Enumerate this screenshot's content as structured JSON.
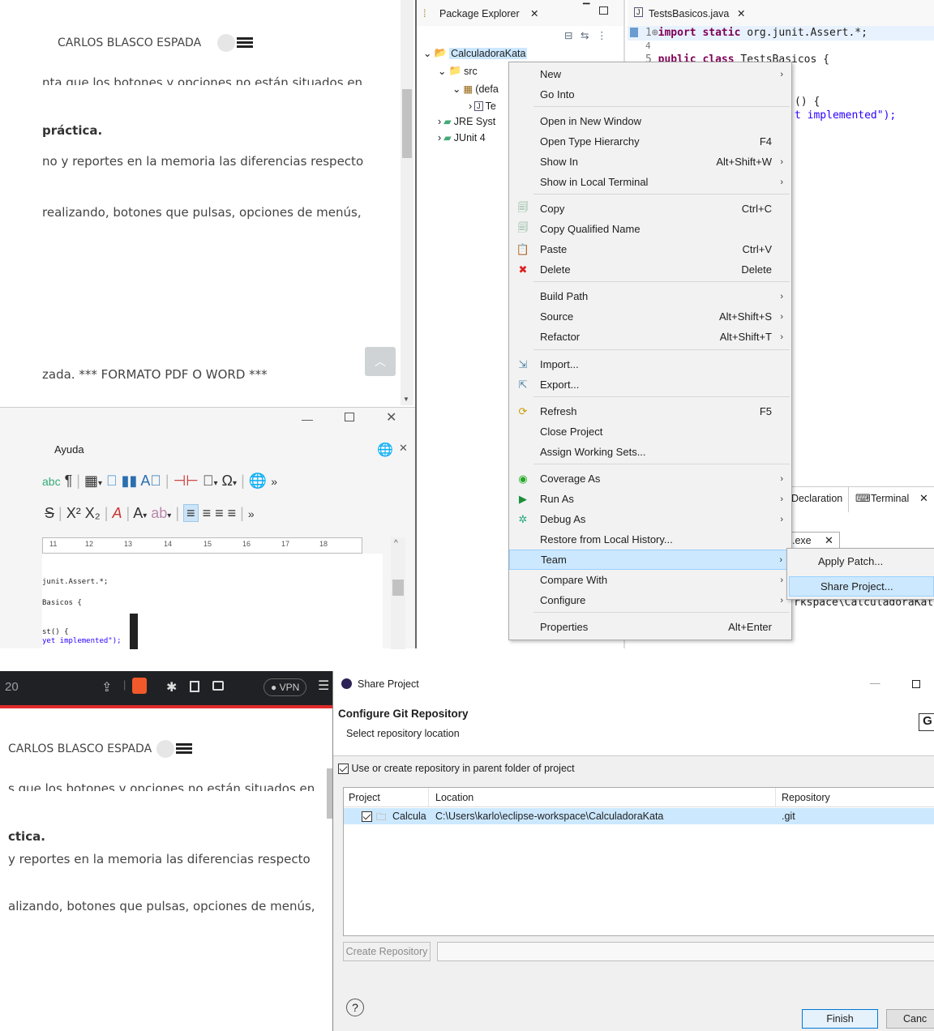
{
  "blog_top": {
    "author": "CARLOS BLASCO ESPADA",
    "line_cut": "nta que los botones y opciones no están situados en",
    "practica": "práctica.",
    "reportes": "no y reportes en la memoria las diferencias respecto",
    "realizando": "realizando, botones que pulsas, opciones de menús,",
    "formato": "zada. *** FORMATO PDF O WORD ***"
  },
  "writer": {
    "menu_label": "Ayuda",
    "ruler_marks": [
      "11",
      "12",
      "13",
      "14",
      "15",
      "16",
      "17",
      "18"
    ],
    "doc_lines": [
      "junit.Assert.*;",
      "Basicos {",
      "st() {",
      "yet implemented\");"
    ]
  },
  "eclipse": {
    "package_explorer_tab": "Package Explorer",
    "editor_tab": "TestsBasicos.java",
    "tree": {
      "project": "CalculadoraKata",
      "src": "src",
      "default_pkg": "(defa",
      "file": "Te",
      "jre": "JRE Syst",
      "junit": "JUnit 4"
    },
    "code": {
      "line1_no": "1⊕",
      "line1_kw": "import static",
      "line1_rest": " org.junit.Assert.*;",
      "line4_no": "4",
      "line5_no": "5",
      "line5_kw": "public class",
      "line5_rest": " TestsBasicos {",
      "line_a": "() {",
      "line_b_str": "t implemented\");"
    },
    "bottom_tabs": {
      "declaration": "Declaration",
      "terminal": "Terminal",
      "exe_tab": ".exe",
      "path": "rkspace\\CalculadoraKata"
    }
  },
  "context_menu": {
    "items": [
      {
        "label": "New",
        "shortcut": "",
        "submenu": true
      },
      {
        "label": "Go Into",
        "shortcut": "",
        "submenu": false
      },
      {
        "label": "Open in New Window",
        "shortcut": "",
        "submenu": false
      },
      {
        "label": "Open Type Hierarchy",
        "shortcut": "F4",
        "submenu": false
      },
      {
        "label": "Show In",
        "shortcut": "Alt+Shift+W",
        "submenu": true
      },
      {
        "label": "Show in Local Terminal",
        "shortcut": "",
        "submenu": true
      },
      {
        "label": "Copy",
        "shortcut": "Ctrl+C",
        "submenu": false
      },
      {
        "label": "Copy Qualified Name",
        "shortcut": "",
        "submenu": false
      },
      {
        "label": "Paste",
        "shortcut": "Ctrl+V",
        "submenu": false
      },
      {
        "label": "Delete",
        "shortcut": "Delete",
        "submenu": false
      },
      {
        "label": "Build Path",
        "shortcut": "",
        "submenu": true
      },
      {
        "label": "Source",
        "shortcut": "Alt+Shift+S",
        "submenu": true
      },
      {
        "label": "Refactor",
        "shortcut": "Alt+Shift+T",
        "submenu": true
      },
      {
        "label": "Import...",
        "shortcut": "",
        "submenu": false
      },
      {
        "label": "Export...",
        "shortcut": "",
        "submenu": false
      },
      {
        "label": "Refresh",
        "shortcut": "F5",
        "submenu": false
      },
      {
        "label": "Close Project",
        "shortcut": "",
        "submenu": false
      },
      {
        "label": "Assign Working Sets...",
        "shortcut": "",
        "submenu": false
      },
      {
        "label": "Coverage As",
        "shortcut": "",
        "submenu": true
      },
      {
        "label": "Run As",
        "shortcut": "",
        "submenu": true
      },
      {
        "label": "Debug As",
        "shortcut": "",
        "submenu": true
      },
      {
        "label": "Restore from Local History...",
        "shortcut": "",
        "submenu": false
      },
      {
        "label": "Team",
        "shortcut": "",
        "submenu": true
      },
      {
        "label": "Compare With",
        "shortcut": "",
        "submenu": true
      },
      {
        "label": "Configure",
        "shortcut": "",
        "submenu": true
      },
      {
        "label": "Properties",
        "shortcut": "Alt+Enter",
        "submenu": false
      }
    ],
    "team_submenu": [
      "Apply Patch...",
      "Share Project..."
    ]
  },
  "browser": {
    "tab_fragment": "20",
    "vpn": "VPN"
  },
  "blog_bottom": {
    "author": "CARLOS BLASCO ESPADA",
    "line_cut": "s que los botones y opciones no están situados en",
    "practica": "ctica.",
    "reportes": "y reportes en la memoria las diferencias respecto",
    "realizando": "alizando, botones que pulsas, opciones de menús,"
  },
  "dialog": {
    "title": "Share Project",
    "heading": "Configure Git Repository",
    "subheading": "Select repository location",
    "checkbox_label": "Use or create repository in parent folder of project",
    "columns": [
      "Project",
      "Location",
      "Repository"
    ],
    "row": {
      "project": "Calcula",
      "location": "C:\\Users\\karlo\\eclipse-workspace\\CalculadoraKata",
      "repository": ".git"
    },
    "create_repo_button": "Create Repository",
    "finish_button": "Finish",
    "cancel_button": "Canc",
    "edge_letter": "G"
  }
}
